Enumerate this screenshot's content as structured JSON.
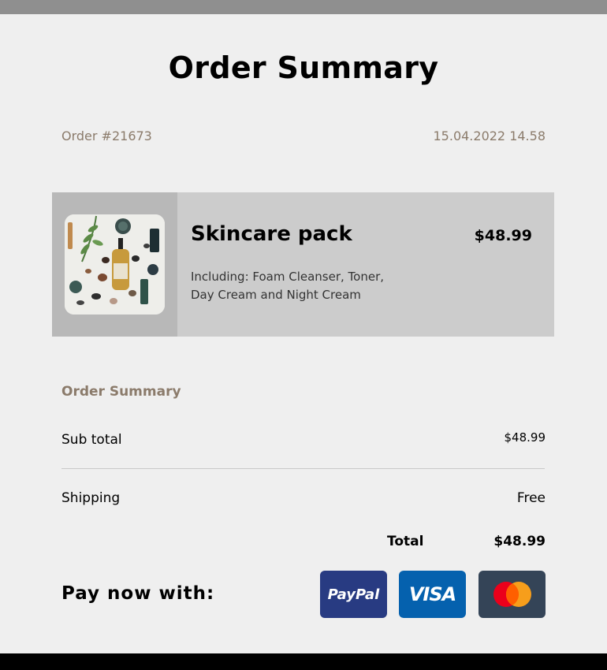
{
  "header": {
    "title": "Order Summary"
  },
  "order": {
    "number": "Order #21673",
    "datetime": "15.04.2022 14.58"
  },
  "product": {
    "name": "Skincare pack",
    "price": "$48.99",
    "description": "Including: Foam Cleanser, Toner, Day Cream and Night Cream",
    "image_icon": "skincare-products-photo"
  },
  "summary": {
    "heading": "Order Summary",
    "subtotal_label": "Sub total",
    "subtotal_value": "$48.99",
    "shipping_label": "Shipping",
    "shipping_value": "Free",
    "total_label": "Total",
    "total_value": "$48.99"
  },
  "payment": {
    "label": "Pay now with:",
    "methods": [
      {
        "name": "PayPal",
        "icon": "paypal-icon",
        "color": "#283b82"
      },
      {
        "name": "VISA",
        "icon": "visa-icon",
        "color": "#0561ae"
      },
      {
        "name": "Mastercard",
        "icon": "mastercard-icon",
        "color": "#344457"
      }
    ]
  },
  "colors": {
    "accent_text": "#8b7b6b",
    "card_bg": "#cccccc",
    "page_bg": "#efefef"
  }
}
